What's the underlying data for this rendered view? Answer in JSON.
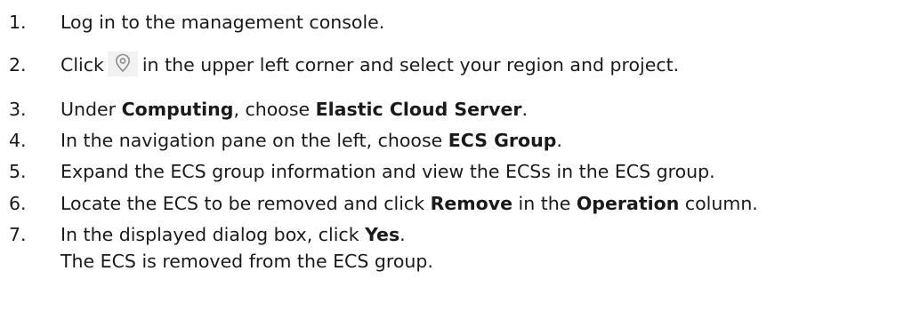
{
  "steps": [
    {
      "num": "1.",
      "t1": "Log in to the management console."
    },
    {
      "num": "2.",
      "t1": "Click",
      "t2": "in the upper left corner and select your region and project.",
      "icon": "location-pin-icon"
    },
    {
      "num": "3.",
      "t1": "Under ",
      "b1": "Computing",
      "t2": ", choose ",
      "b2": "Elastic Cloud Server",
      "t3": "."
    },
    {
      "num": "4.",
      "t1": "In the navigation pane on the left, choose ",
      "b1": "ECS Group",
      "t2": "."
    },
    {
      "num": "5.",
      "t1": "Expand the ECS group information and view the ECSs in the ECS group."
    },
    {
      "num": "6.",
      "t1": "Locate the ECS to be removed and click ",
      "b1": "Remove",
      "t2": " in the ",
      "b2": "Operation",
      "t3": " column."
    },
    {
      "num": "7.",
      "t1": "In the displayed dialog box, click ",
      "b1": "Yes",
      "t2": "."
    }
  ],
  "result": "The ECS is removed from the ECS group.",
  "colors": {
    "text": "#1a1a1a",
    "icon": "#8c8c8c",
    "icon_bg": "#f2f2f2"
  }
}
